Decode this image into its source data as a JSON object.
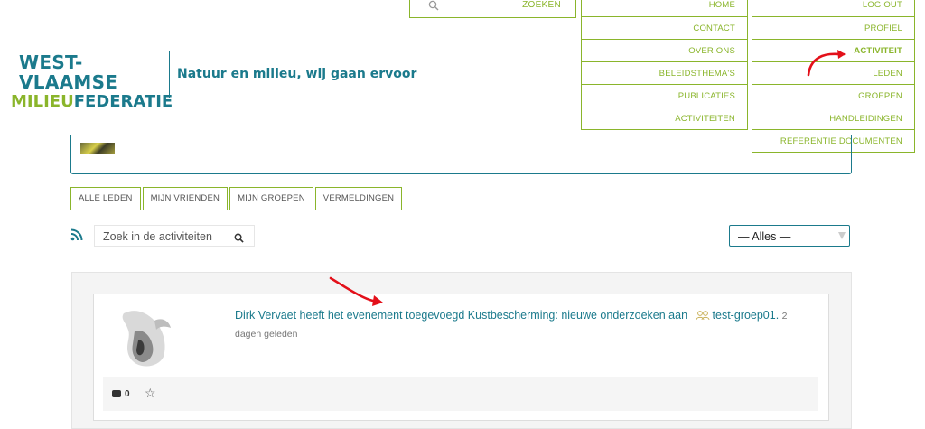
{
  "brand": {
    "line1": "WEST-VLAAMSE",
    "line2_a": "MILIEU",
    "line2_b": "FEDERATIE",
    "tagline": "Natuur en milieu, wij gaan ervoor",
    "colors": {
      "teal": "#1b7a8c",
      "green": "#8ab52b"
    }
  },
  "header_search": {
    "label": "ZOEKEN",
    "icon": "search-icon"
  },
  "main_menu": [
    "HOME",
    "CONTACT",
    "OVER ONS",
    "BELEIDSTHEMA'S",
    "PUBLICATIES",
    "ACTIVITEITEN"
  ],
  "user_menu": [
    "LOG OUT",
    "PROFIEL",
    "ACTIVITEIT",
    "LEDEN",
    "GROEPEN",
    "HANDLEIDINGEN",
    "REFERENTIE DOCUMENTEN"
  ],
  "user_menu_active": "ACTIVITEIT",
  "tabs": [
    "ALLE LEDEN",
    "MIJN VRIENDEN",
    "MIJN GROEPEN",
    "VERMELDINGEN"
  ],
  "activity_search": {
    "placeholder": "Zoek in de activiteiten",
    "icon": "search-icon"
  },
  "filter": {
    "selected": "— Alles —"
  },
  "activity": {
    "text": "Dirk Vervaet heeft het evenement toegevoegd Kustbescherming: nieuwe onderzoeken aan",
    "group": "test-groep01.",
    "when_a": "2",
    "when_b": "dagen geleden",
    "comments": "0"
  }
}
